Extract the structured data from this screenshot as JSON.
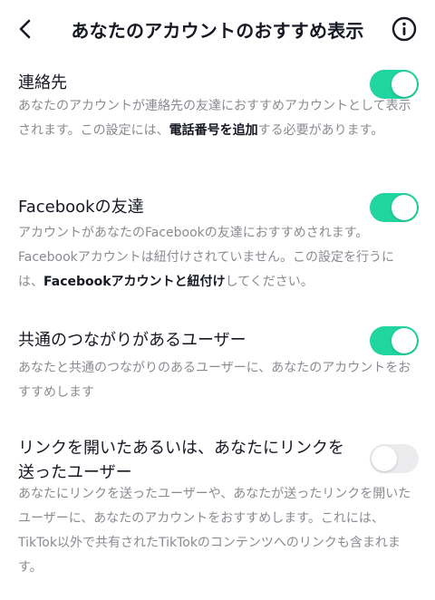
{
  "header": {
    "back_icon": "chevron-left-icon",
    "title": "あなたのアカウントのおすすめ表示",
    "info_icon": "info-circle-icon"
  },
  "settings": [
    {
      "title": "連絡先",
      "desc_pre": "あなたのアカウントが連絡先の友達におすすめアカウントとして表示されます。この設定には、",
      "desc_bold": "電話番号を追加",
      "desc_post": "する必要があります。",
      "enabled": true
    },
    {
      "title": "Facebookの友達",
      "desc_pre": "アカウントがあなたのFacebookの友達におすすめされます。Facebookアカウントは紐付けされていません。この設定を行うには、",
      "desc_bold": "Facebookアカウントと紐付け",
      "desc_post": "してください。",
      "enabled": true
    },
    {
      "title": "共通のつながりがあるユーザー",
      "desc": "あなたと共通のつながりのあるユーザーに、あなたのアカウントをおすすめします",
      "enabled": true
    },
    {
      "title": "リンクを開いたあるいは、あなたにリンクを送ったユーザー",
      "desc": "あなたにリンクを送ったユーザーや、あなたが送ったリンクを開いたユーザーに、あなたのアカウントをおすすめします。これには、TikTok以外で共有されたTikTokのコンテンツへのリンクも含まれます。",
      "enabled": false
    }
  ],
  "colors": {
    "toggle_on": "#20d5a0",
    "toggle_off": "#ececee",
    "secondary_text": "#8a8b91"
  }
}
